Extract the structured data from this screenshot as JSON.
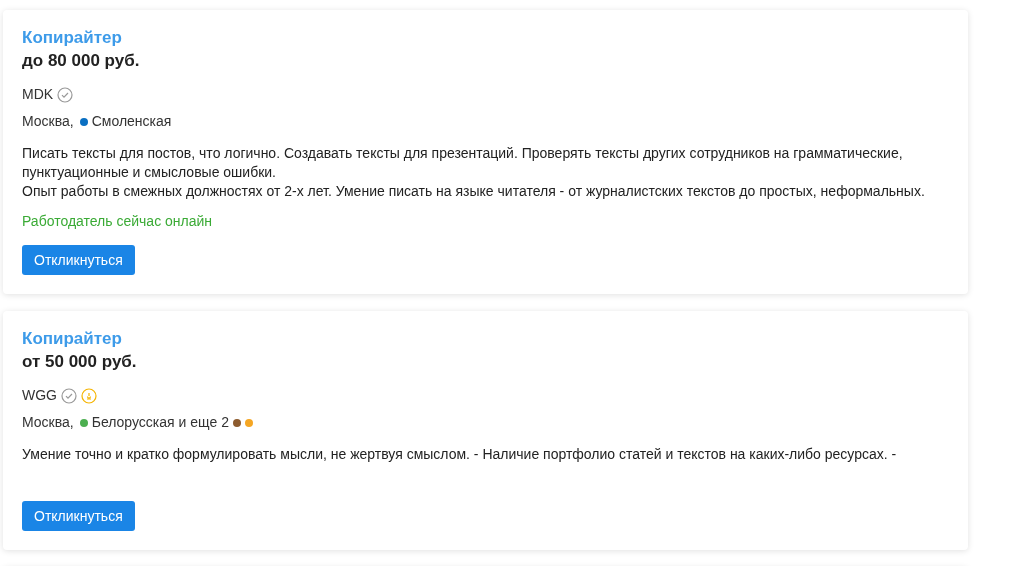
{
  "vacancies": [
    {
      "title": "Копирайтер",
      "salary": "до 80 000 руб.",
      "company": "MDK",
      "badges": [
        {
          "kind": "verified"
        }
      ],
      "city": "Москва,",
      "metro": [
        {
          "name": "Смоленская",
          "color": "#0a6fc2"
        }
      ],
      "description": [
        "Писать тексты для постов, что логично. Создавать тексты для презентаций. Проверять тексты других сотрудников на грамматические, пунктуационные и смысловые ошибки.",
        "Опыт работы в смежных должностях от 2-х лет. Умение писать на языке читателя - от журналистских текстов до простых, неформальных."
      ],
      "online": "Работодатель сейчас онлайн",
      "button": "Откликнуться"
    },
    {
      "title": "Копирайтер",
      "salary": "от 50 000 руб.",
      "company": "WGG",
      "badges": [
        {
          "kind": "verified"
        },
        {
          "kind": "award"
        }
      ],
      "city": "Москва,",
      "metro": [
        {
          "name": "Белорусская",
          "color": "#4caf50"
        }
      ],
      "metro_more": "и еще 2",
      "extra_metro": [
        {
          "color": "#8d5b2e"
        },
        {
          "color": "#f5a623"
        }
      ],
      "description": [
        "Умение точно и кратко формулировать мысли, не жертвуя смыслом. - Наличие портфолио статей и текстов на каких-либо ресурсах. -"
      ],
      "button": "Откликнуться"
    }
  ]
}
